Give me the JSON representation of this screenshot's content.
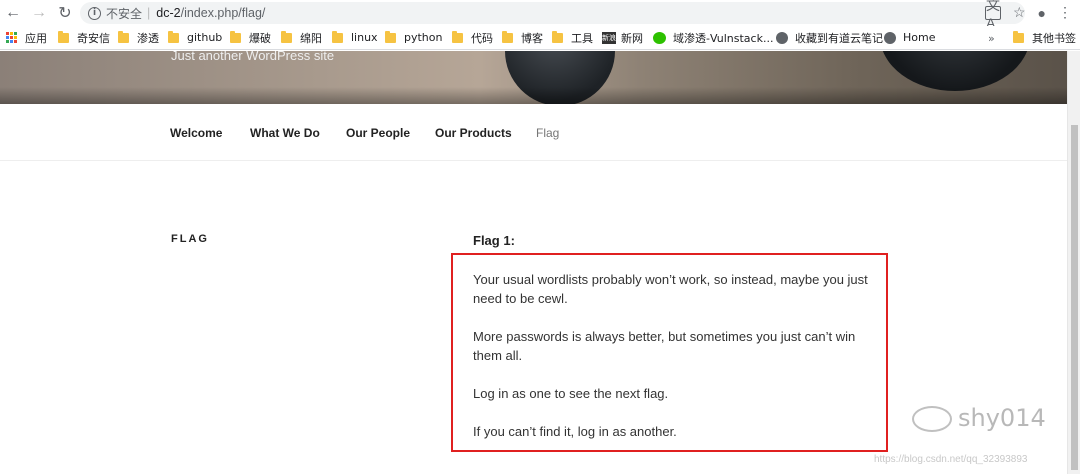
{
  "browser": {
    "insecure_label": "不安全",
    "separator": "|",
    "url_host": "dc-2",
    "url_path": "/index.php/flag/"
  },
  "bookmarks": {
    "items": [
      "应用",
      "奇安信",
      "渗透",
      "github",
      "爆破",
      "绵阳",
      "linux",
      "python",
      "代码",
      "博客",
      "工具",
      "新网",
      "域渗透-Vulnstack...",
      "收藏到有道云笔记",
      "Home"
    ],
    "more": "»",
    "other": "其他书签",
    "news_icon_text": "新浪"
  },
  "site": {
    "tagline": "Just another WordPress site",
    "nav": [
      "Welcome",
      "What We Do",
      "Our People",
      "Our Products",
      "Flag"
    ]
  },
  "page": {
    "title": "FLAG",
    "flag_heading": "Flag 1:",
    "paragraphs": [
      "Your usual wordlists probably won’t work, so instead, maybe you just need to be cewl.",
      "More passwords is always better, but sometimes you just can’t win them all.",
      "Log in as one to see the next flag.",
      "If you can’t find it, log in as another."
    ]
  },
  "watermark": {
    "name": "shy014",
    "csdn": "https://blog.csdn.net/qq_32393893"
  },
  "colors": {
    "highlight_box": "#e02020"
  }
}
